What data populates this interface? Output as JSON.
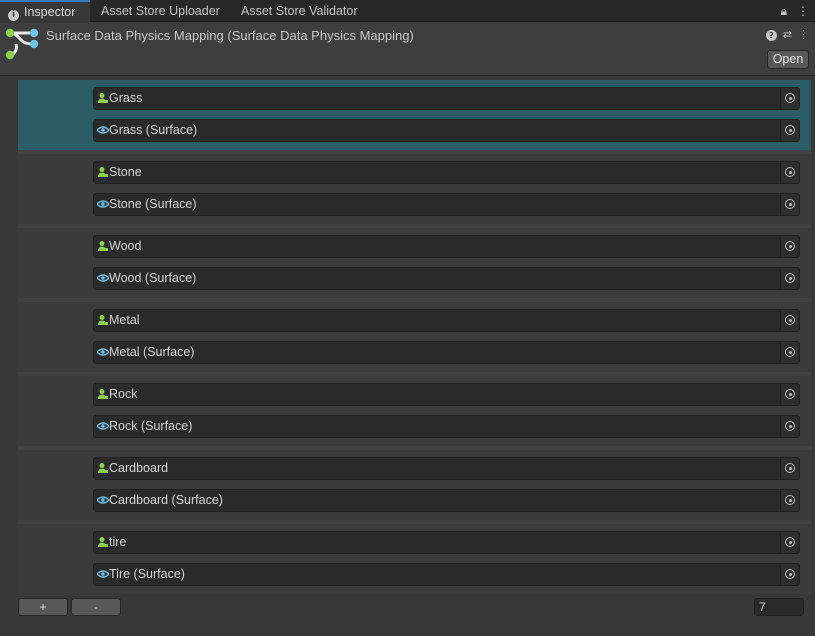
{
  "tabs": [
    {
      "label": "Inspector",
      "active": true
    },
    {
      "label": "Asset Store Uploader"
    },
    {
      "label": "Asset Store Validator"
    }
  ],
  "header": {
    "title": "Surface Data Physics Mapping (Surface Data Physics Mapping)",
    "open_label": "Open"
  },
  "items": [
    {
      "material": "Grass",
      "surface": "Grass (Surface)",
      "selected": true
    },
    {
      "material": "Stone",
      "surface": "Stone (Surface)"
    },
    {
      "material": "Wood",
      "surface": "Wood (Surface)"
    },
    {
      "material": "Metal",
      "surface": "Metal (Surface)"
    },
    {
      "material": "Rock",
      "surface": "Rock (Surface)"
    },
    {
      "material": "Cardboard",
      "surface": "Cardboard (Surface)"
    },
    {
      "material": "tire",
      "surface": "Tire (Surface)"
    }
  ],
  "footer": {
    "add_label": "+",
    "remove_label": "-",
    "count": "7"
  },
  "colors": {
    "selection": "#2c5d67",
    "accent": "#3a79bb",
    "physics_icon": "#8bd24a",
    "surface_icon": "#6fc3e8"
  },
  "icons": {
    "material_field": "physic-material-icon",
    "surface_field": "surface-data-icon",
    "picker": "object-picker-icon"
  }
}
